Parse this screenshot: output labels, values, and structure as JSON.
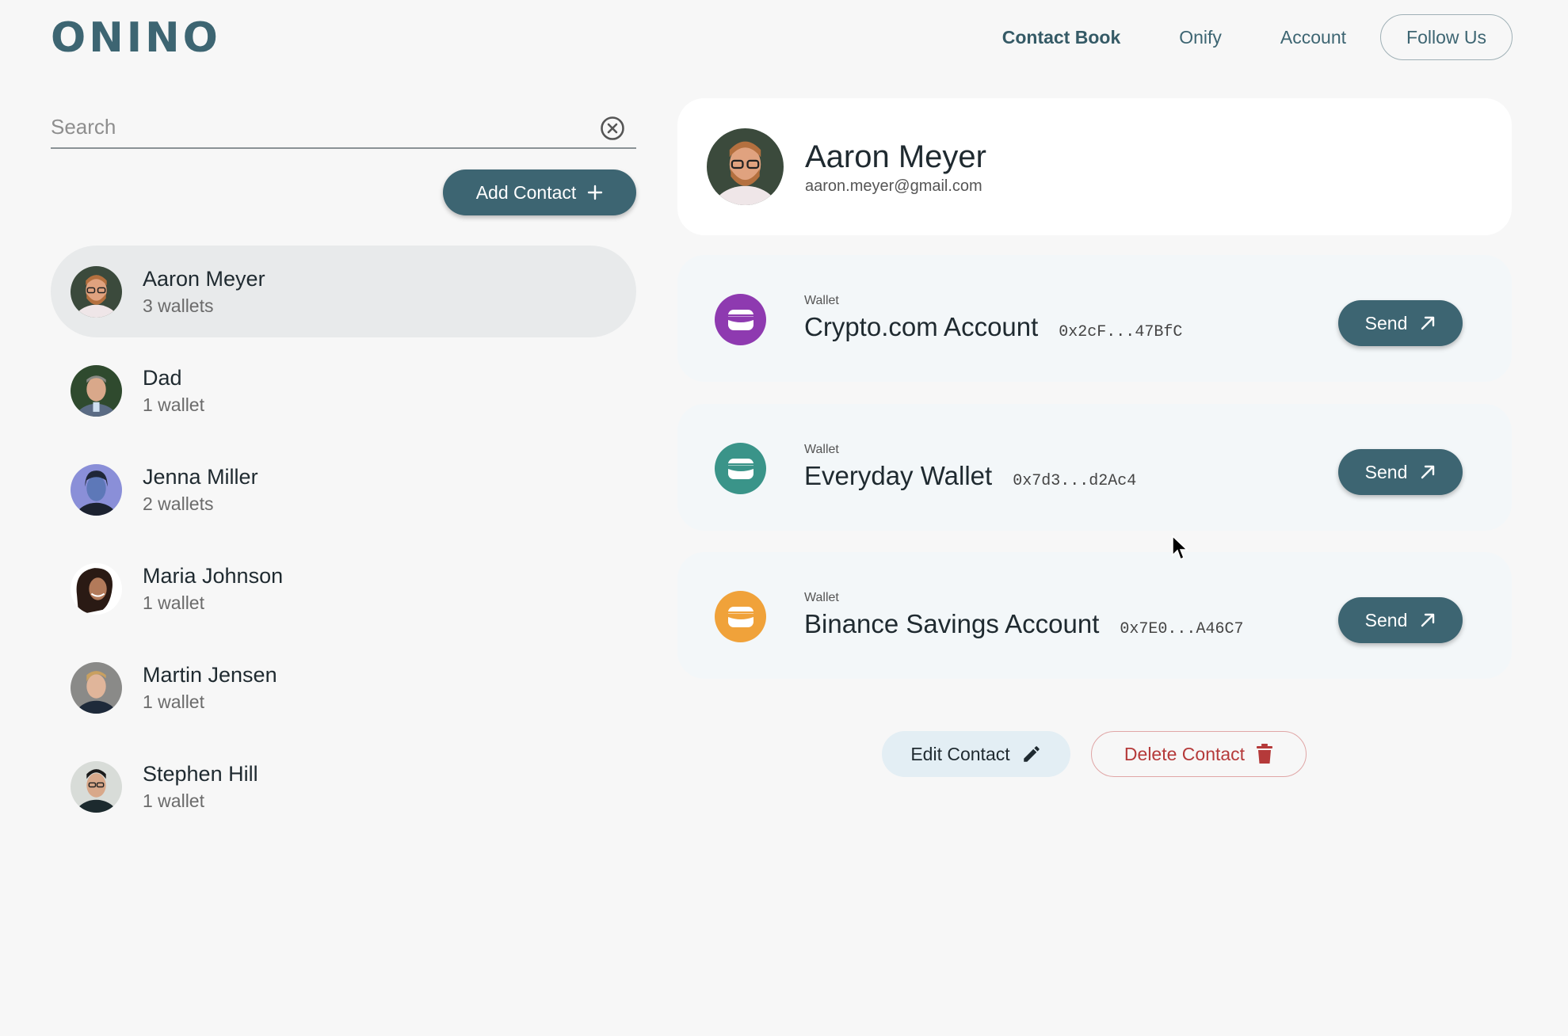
{
  "header": {
    "logo": "ONINO",
    "nav": {
      "contact_book": "Contact Book",
      "onify": "Onify",
      "account": "Account",
      "follow_us": "Follow Us"
    }
  },
  "search": {
    "placeholder": "Search",
    "value": ""
  },
  "add_contact": {
    "label": "Add Contact"
  },
  "contacts": [
    {
      "name": "Aaron Meyer",
      "wallets": "3 wallets",
      "selected": true
    },
    {
      "name": "Dad",
      "wallets": "1 wallet"
    },
    {
      "name": "Jenna Miller",
      "wallets": "2 wallets"
    },
    {
      "name": "Maria Johnson",
      "wallets": "1 wallet"
    },
    {
      "name": "Martin Jensen",
      "wallets": "1 wallet"
    },
    {
      "name": "Stephen Hill",
      "wallets": "1 wallet"
    }
  ],
  "profile": {
    "name": "Aaron Meyer",
    "email": "aaron.meyer@gmail.com"
  },
  "wallets": [
    {
      "label": "Wallet",
      "name": "Crypto.com Account",
      "address": "0x2cF...47BfC",
      "color": "#8e3ab0",
      "send": "Send"
    },
    {
      "label": "Wallet",
      "name": "Everyday Wallet",
      "address": "0x7d3...d2Ac4",
      "color": "#3a9489",
      "send": "Send"
    },
    {
      "label": "Wallet",
      "name": "Binance Savings Account",
      "address": "0x7E0...A46C7",
      "color": "#f0a23a",
      "send": "Send"
    }
  ],
  "actions": {
    "edit": "Edit Contact",
    "delete": "Delete Contact"
  },
  "colors": {
    "primary": "#3d6572",
    "background": "#f7f7f7",
    "danger": "#b53a3a"
  }
}
